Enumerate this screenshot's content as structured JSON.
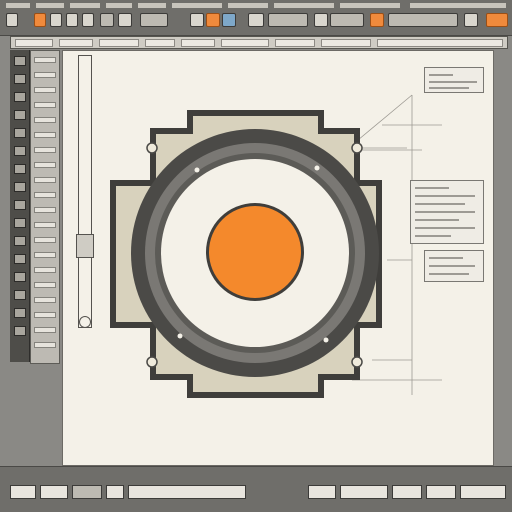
{
  "toolbar": {
    "buttons": [
      "new-file",
      "open-file",
      "save-file",
      "undo",
      "redo",
      "select-tool",
      "move-tool",
      "layers",
      "zoom",
      "grid",
      "snap",
      "measure",
      "settings",
      "run-button"
    ],
    "colors": {
      "bg": "#6f6e6a",
      "accent": "#f08a3c",
      "blue": "#7ea8c9"
    }
  },
  "subbar": {
    "segments": 9
  },
  "tools": {
    "count": 16
  },
  "panel": {
    "rows": 20
  },
  "canvas": {
    "callout_top": {
      "label": "IIIII"
    },
    "callout_mid": {
      "label": ""
    },
    "callout_low": {
      "label": ""
    }
  },
  "drawing": {
    "outer_color": "#3f3e3b",
    "frame_fill": "#d8d2bd",
    "ring_dark": "#4b4a47",
    "inner_fill": "#f4f1e8",
    "core_fill": "#f4892c"
  },
  "statusbar": {
    "readout": "",
    "segments": 8
  }
}
